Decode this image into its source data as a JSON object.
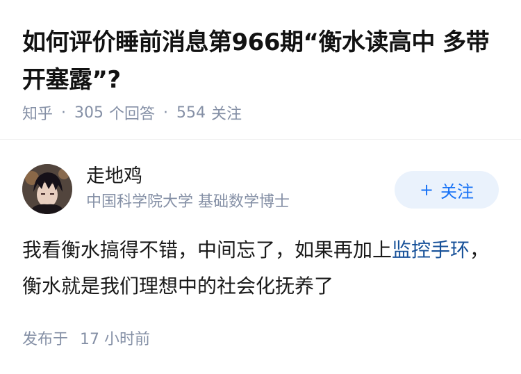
{
  "question": {
    "title": "如何评价睡前消息第966期“衡水读高中 多带开塞露”?",
    "source": "知乎",
    "answer_count": "305",
    "answer_label": "个回答",
    "follow_count": "554",
    "follow_label": "关注"
  },
  "author": {
    "name": "走地鸡",
    "bio": "中国科学院大学 基础数学博士",
    "follow_button": "关注",
    "follow_icon": "plus-icon"
  },
  "answer": {
    "text_before": "我看衡水搞得不错，中间忘了，如果再加上",
    "link_text": "监控手环",
    "text_after": "，衡水就是我们理想中的社会化抚养了",
    "link_color": "#175199"
  },
  "published": {
    "label": "发布于",
    "time": "17 小时前"
  },
  "colors": {
    "meta": "#8590a6",
    "accent": "#1772f6",
    "button_bg": "#eaf2fc"
  }
}
